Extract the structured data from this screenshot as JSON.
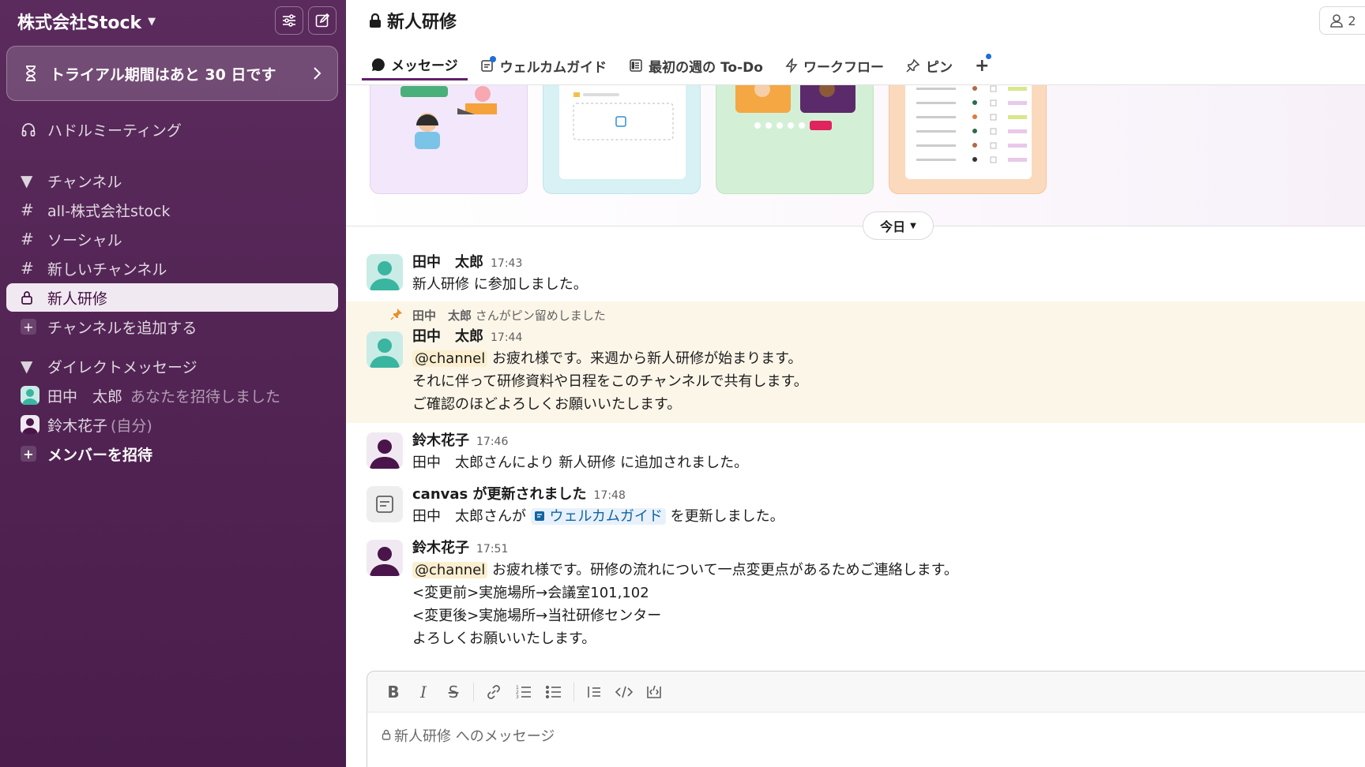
{
  "sidebar": {
    "workspace_name": "株式会社Stock",
    "trial_banner": "トライアル期間はあと 30 日です",
    "huddle": "ハドルミーティング",
    "channels_header": "チャンネル",
    "channels": [
      {
        "name": "all-株式会社stock",
        "icon": "#"
      },
      {
        "name": "ソーシャル",
        "icon": "#"
      },
      {
        "name": "新しいチャンネル",
        "icon": "#"
      },
      {
        "name": "新人研修",
        "icon": "lock"
      }
    ],
    "add_channel": "チャンネルを追加する",
    "dm_header": "ダイレクトメッセージ",
    "dms": [
      {
        "name": "田中　太郎",
        "note": "あなたを招待しました"
      },
      {
        "name": "鈴木花子",
        "note": "(自分)"
      }
    ],
    "invite": "メンバーを招待"
  },
  "channel": {
    "title": "新人研修",
    "member_count": "2",
    "tabs": [
      {
        "label": "メッセージ"
      },
      {
        "label": "ウェルカムガイド"
      },
      {
        "label": "最初の週の To-Do"
      },
      {
        "label": "ワークフロー"
      },
      {
        "label": "ピン"
      }
    ],
    "day_label": "今日"
  },
  "messages": [
    {
      "user": "田中　太郎",
      "time": "17:43",
      "lines": [
        "新人研修 に参加しました。"
      ]
    },
    {
      "pin_notice_user": "田中　太郎",
      "pin_notice_text": "さんがピン留めしました",
      "user": "田中　太郎",
      "time": "17:44",
      "mention": "@channel",
      "lines": [
        "お疲れ様です。来週から新人研修が始まります。",
        "それに伴って研修資料や日程をこのチャンネルで共有します。",
        "ご確認のほどよろしくお願いいたします。"
      ]
    },
    {
      "user": "鈴木花子",
      "time": "17:46",
      "lines": [
        "田中　太郎さんにより 新人研修 に追加されました。"
      ]
    },
    {
      "user": "canvas が更新されました",
      "time": "17:48",
      "pre": "田中　太郎さんが",
      "link": "ウェルカムガイド",
      "post": "を更新しました。"
    },
    {
      "user": "鈴木花子",
      "time": "17:51",
      "mention": "@channel",
      "lines": [
        "お疲れ様です。研修の流れについて一点変更点があるためご連絡します。",
        "<変更前>実施場所→会議室101,102",
        "<変更後>実施場所→当社研修センター",
        "よろしくお願いいたします。"
      ]
    }
  ],
  "composer": {
    "placeholder": "新人研修 へのメッセージ"
  },
  "colors": {
    "sidebar_bg": "#4a1d4c",
    "accent": "#611f69",
    "mention_bg": "#fbefd0",
    "pinned_bg": "#fcf6e8",
    "link": "#1264a3"
  }
}
